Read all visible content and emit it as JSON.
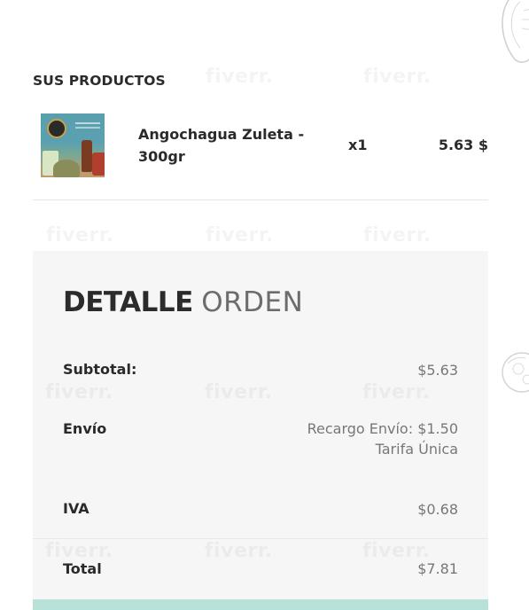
{
  "products_section": {
    "title": "SUS PRODUCTOS",
    "items": [
      {
        "name": "Angochagua Zuleta - 300gr",
        "quantity": "x1",
        "price": "5.63 $"
      }
    ]
  },
  "order_detail": {
    "title_bold": "DETALLE",
    "title_light": "ORDEN",
    "rows": [
      {
        "label": "Subtotal:",
        "value": "$5.63"
      },
      {
        "label": "Envío",
        "value_line1": "Recargo Envío: $1.50",
        "value_line2": "Tarifa Única"
      },
      {
        "label": "IVA",
        "value": "$0.68"
      },
      {
        "label": "Total",
        "value": "$7.81"
      }
    ]
  },
  "watermark": "fiverr.",
  "colors": {
    "accent": "#b8e2d8",
    "card_bg": "#f6f6f6",
    "text": "#2a2a2a",
    "muted": "#777777"
  },
  "icons": [
    "product-thumbnail",
    "decorative-sketch-art"
  ]
}
